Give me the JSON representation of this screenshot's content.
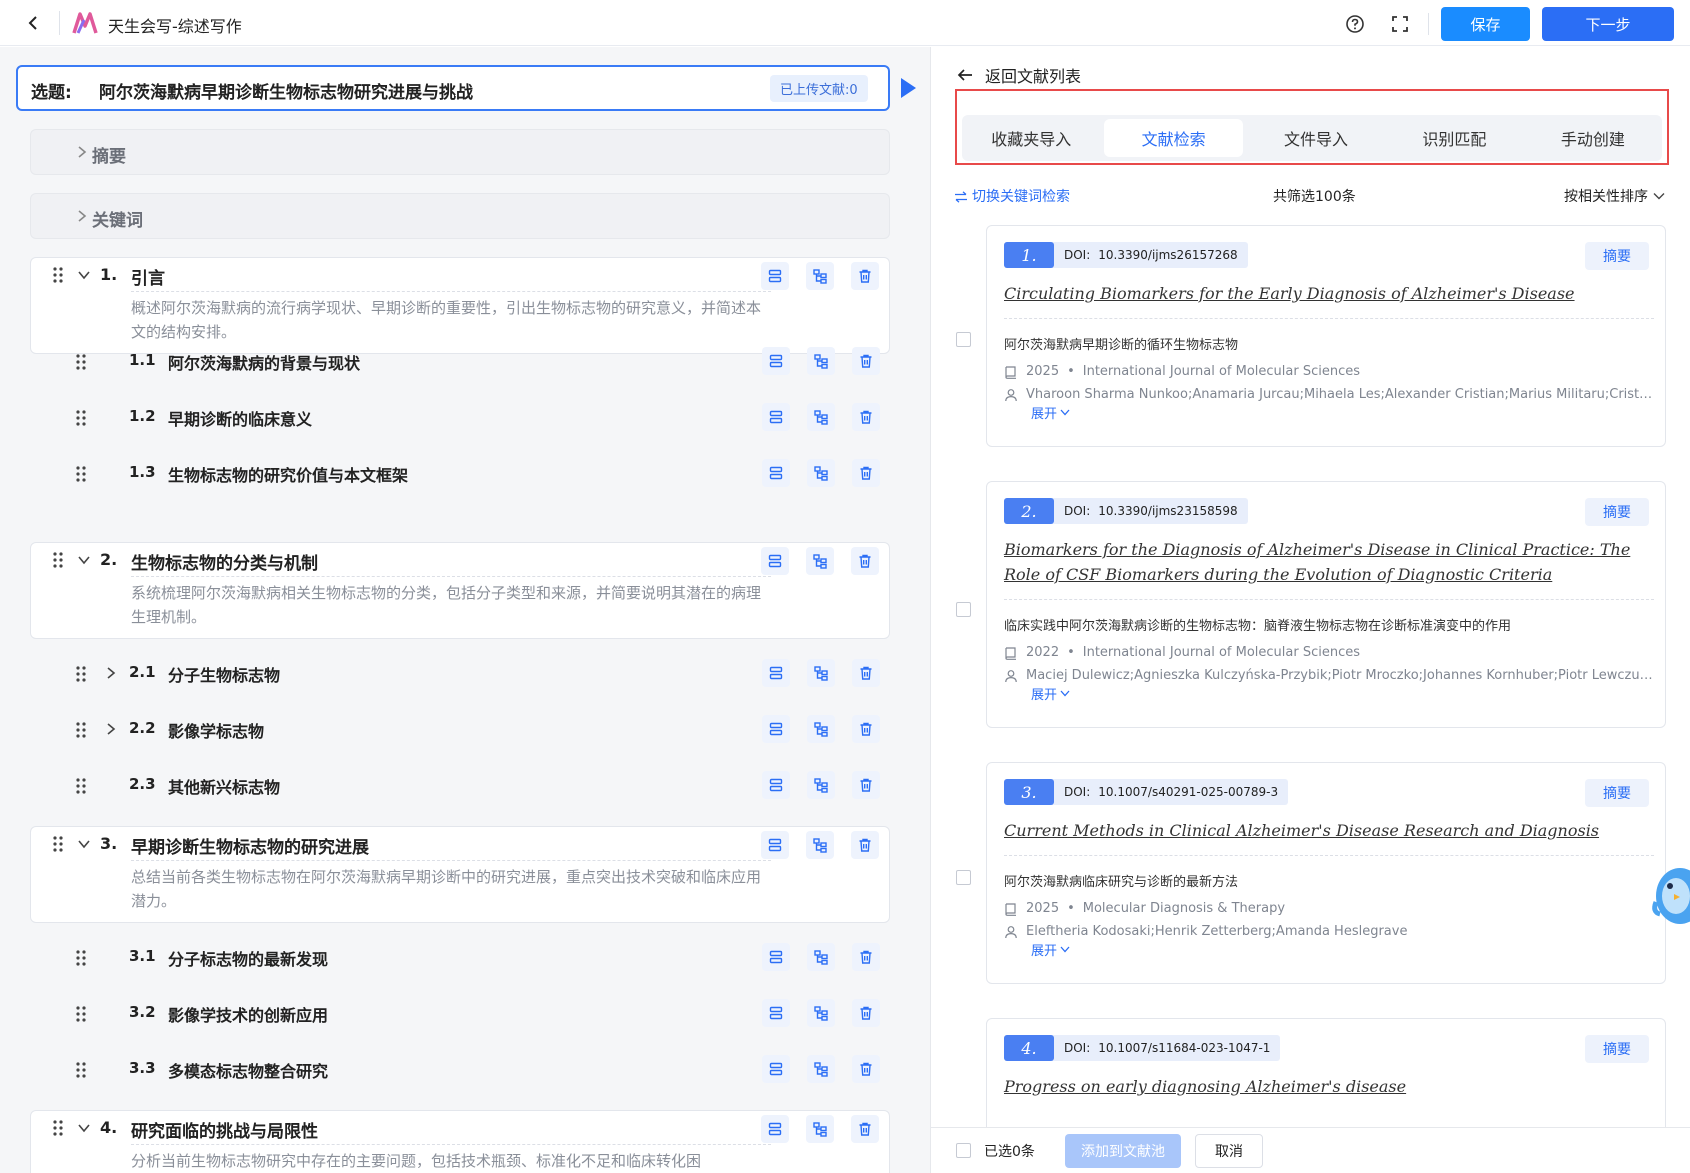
{
  "header": {
    "app_title": "天生会写-综述写作",
    "save_label": "保存",
    "next_label": "下一步"
  },
  "topic": {
    "label": "选题:",
    "text": "阿尔茨海默病早期诊断生物标志物研究进展与挑战",
    "uploaded": "已上传文献:0"
  },
  "sections": {
    "abstract": "摘要",
    "keywords": "关键词"
  },
  "outline": {
    "ch1": {
      "num": "1.",
      "title": "引言",
      "desc": "概述阿尔茨海默病的流行病学现状、早期诊断的重要性，引出生物标志物的研究意义，并简述本文的结构安排。"
    },
    "s11": {
      "num": "1.1",
      "title": "阿尔茨海默病的背景与现状"
    },
    "s12": {
      "num": "1.2",
      "title": "早期诊断的临床意义"
    },
    "s13": {
      "num": "1.3",
      "title": "生物标志物的研究价值与本文框架"
    },
    "ch2": {
      "num": "2.",
      "title": "生物标志物的分类与机制",
      "desc": "系统梳理阿尔茨海默病相关生物标志物的分类，包括分子类型和来源，并简要说明其潜在的病理生理机制。"
    },
    "s21": {
      "num": "2.1",
      "title": "分子生物标志物"
    },
    "s22": {
      "num": "2.2",
      "title": "影像学标志物"
    },
    "s23": {
      "num": "2.3",
      "title": "其他新兴标志物"
    },
    "ch3": {
      "num": "3.",
      "title": "早期诊断生物标志物的研究进展",
      "desc": "总结当前各类生物标志物在阿尔茨海默病早期诊断中的研究进展，重点突出技术突破和临床应用潜力。"
    },
    "s31": {
      "num": "3.1",
      "title": "分子标志物的最新发现"
    },
    "s32": {
      "num": "3.2",
      "title": "影像学技术的创新应用"
    },
    "s33": {
      "num": "3.3",
      "title": "多模态标志物整合研究"
    },
    "ch4": {
      "num": "4.",
      "title": "研究面临的挑战与局限性",
      "desc": "分析当前生物标志物研究中存在的主要问题，包括技术瓶颈、标准化不足和临床转化困"
    }
  },
  "right": {
    "back_label": "返回文献列表",
    "tabs": [
      "收藏夹导入",
      "文献检索",
      "文件导入",
      "识别匹配",
      "手动创建"
    ],
    "switch_keyword": "切换关键词检索",
    "count": "共筛选100条",
    "sort": "按相关性排序",
    "doi_label": "DOI:",
    "abstract_label": "摘要",
    "expand_label": "展开"
  },
  "papers": [
    {
      "idx": "1.",
      "doi": "10.3390/ijms26157268",
      "title_en": "Circulating Biomarkers for the Early Diagnosis of Alzheimer's Disease",
      "title_cn": "阿尔茨海默病早期诊断的循环生物标志物",
      "year": "2025",
      "journal": "International Journal of Molecular Sciences",
      "authors": "Vharoon Sharma Nunkoo;Anamaria Jurcau;Mihaela Les;Alexander Cristian;Marius Militaru;Cristia..."
    },
    {
      "idx": "2.",
      "doi": "10.3390/ijms23158598",
      "title_en": "Biomarkers for the Diagnosis of Alzheimer's Disease in Clinical Practice: The Role of CSF Biomarkers during the Evolution of Diagnostic Criteria",
      "title_cn": "临床实践中阿尔茨海默病诊断的生物标志物：脑脊液生物标志物在诊断标准演变中的作用",
      "year": "2022",
      "journal": "International Journal of Molecular Sciences",
      "authors": "Maciej Dulewicz;Agnieszka Kulczyńska-Przybik;Piotr Mroczko;Johannes Kornhuber;Piotr Lewczuk..."
    },
    {
      "idx": "3.",
      "doi": "10.1007/s40291-025-00789-3",
      "title_en": "Current Methods in Clinical Alzheimer's Disease Research and Diagnosis",
      "title_cn": "阿尔茨海默病临床研究与诊断的最新方法",
      "year": "2025",
      "journal": "Molecular Diagnosis & Therapy",
      "authors": "Eleftheria Kodosaki;Henrik Zetterberg;Amanda Heslegrave"
    },
    {
      "idx": "4.",
      "doi": "10.1007/s11684-023-1047-1",
      "title_en": "Progress on early diagnosing Alzheimer's disease"
    }
  ],
  "footer": {
    "selected": "已选0条",
    "add_label": "添加到文献池",
    "cancel_label": "取消"
  },
  "colors": {
    "accent": "#2b6ef5",
    "save": "#1a8cff",
    "highlight": "#e84a4a"
  }
}
